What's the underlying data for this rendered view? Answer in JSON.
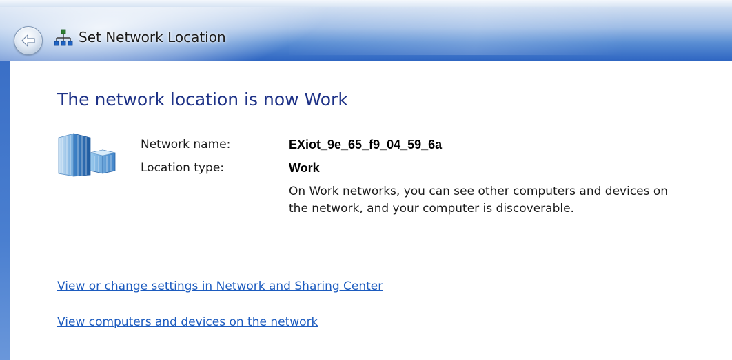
{
  "window": {
    "title": "Set Network Location"
  },
  "main": {
    "heading": "The network location is now Work",
    "network_name_label": "Network name:",
    "network_name_value": "EXiot_9e_65_f9_04_59_6a",
    "location_type_label": "Location type:",
    "location_type_value": "Work",
    "description": "On Work networks, you can see other computers and devices on the network, and your computer is discoverable."
  },
  "links": {
    "network_sharing_center": "View or change settings in Network and Sharing Center",
    "view_computers": "View computers and devices on the network"
  },
  "icons": {
    "back": "back-arrow-icon",
    "title": "network-icon",
    "location": "building-icon"
  },
  "colors": {
    "heading": "#1e3287",
    "link": "#1c5bbf",
    "titlebar": "#2f66c2"
  }
}
